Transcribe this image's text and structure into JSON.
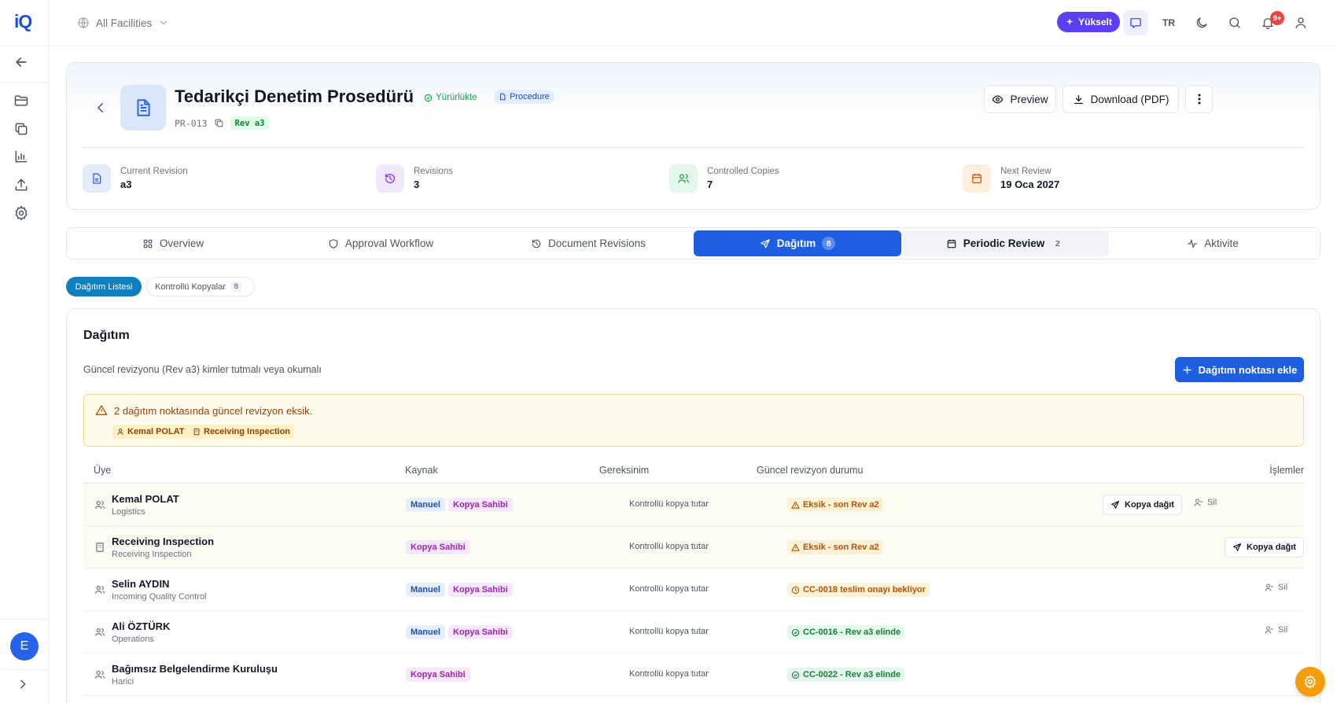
{
  "app": {
    "logo": "iQ"
  },
  "topbar": {
    "facility": "All Facilities",
    "upgrade": "Yükselt",
    "language": "TR",
    "notifications": "9+"
  },
  "document": {
    "title": "Tedarikçi Denetim Prosedürü",
    "status": "Yürürlükte",
    "type": "Procedure",
    "code": "PR-013",
    "revision_badge": "Rev a3",
    "preview_label": "Preview",
    "download_label": "Download (PDF)"
  },
  "stats": [
    {
      "label": "Current Revision",
      "value": "a3"
    },
    {
      "label": "Revisions",
      "value": "3"
    },
    {
      "label": "Controlled Copies",
      "value": "7"
    },
    {
      "label": "Next Review",
      "value": "19 Oca 2027"
    }
  ],
  "tabs": [
    {
      "label": "Overview",
      "count": ""
    },
    {
      "label": "Approval Workflow",
      "count": ""
    },
    {
      "label": "Document Revisions",
      "count": ""
    },
    {
      "label": "Dağıtım",
      "count": "8"
    },
    {
      "label": "Periodic Review",
      "count": "2"
    },
    {
      "label": "Aktivite",
      "count": ""
    }
  ],
  "subtabs": [
    {
      "label": "Dağıtım Listesi",
      "count": ""
    },
    {
      "label": "Kontrollü Kopyalar",
      "count": "8"
    }
  ],
  "distribution": {
    "title": "Dağıtım",
    "subtitle": "Güncel revizyonu (Rev a3) kimler tutmalı veya okumalı",
    "add_label": "Dağıtım noktası ekle",
    "warning": {
      "text": "2 dağıtım noktasında güncel revizyon eksik.",
      "chips": [
        "Kemal POLAT",
        "Receiving Inspection"
      ]
    },
    "columns": [
      "Üye",
      "Kaynak",
      "Gereksinim",
      "Güncel revizyon durumu",
      "İşlemler"
    ],
    "rows": [
      {
        "name": "Kemal POLAT",
        "dept": "Logistics",
        "sources": [
          "Manuel",
          "Kopya Sahibi"
        ],
        "requirement": "Kontrollü kopya tutar",
        "status": "Eksik - son Rev a2",
        "distribute": "Kopya dağıt",
        "delete": "Sil"
      },
      {
        "name": "Receiving Inspection",
        "dept": "Receiving Inspection",
        "sources": [
          "Kopya Sahibi"
        ],
        "requirement": "Kontrollü kopya tutar",
        "status": "Eksik - son Rev a2",
        "distribute": "Kopya dağıt",
        "delete": ""
      },
      {
        "name": "Selin AYDIN",
        "dept": "Incoming Quality Control",
        "sources": [
          "Manuel",
          "Kopya Sahibi"
        ],
        "requirement": "Kontrollü kopya tutar",
        "status": "CC-0018 teslim onayı bekliyor",
        "distribute": "",
        "delete": "Sil"
      },
      {
        "name": "Ali ÖZTÜRK",
        "dept": "Operations",
        "sources": [
          "Manuel",
          "Kopya Sahibi"
        ],
        "requirement": "Kontrollü kopya tutar",
        "status": "CC-0016 - Rev a3 elinde",
        "distribute": "",
        "delete": "Sil"
      },
      {
        "name": "Bağımsız Belgelendirme Kuruluşu",
        "dept": "Harici",
        "sources": [
          "Kopya Sahibi"
        ],
        "requirement": "Kontrollü kopya tutar",
        "status": "CC-0022 - Rev a3 elinde",
        "distribute": "",
        "delete": ""
      }
    ]
  },
  "avatar": {
    "initial": "E"
  },
  "colors": {
    "primary": "#1d5fe0",
    "upgrade": "#5b3ff0",
    "warning_bg": "#fefbea",
    "success": "#16a34a",
    "fab": "#f59e0b"
  }
}
